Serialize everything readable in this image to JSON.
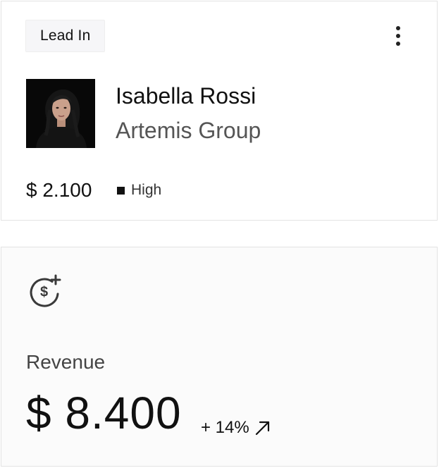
{
  "lead_card": {
    "stage_tag": "Lead In",
    "menu_icon": "more-vertical-icon",
    "contact": {
      "name": "Isabella Rossi",
      "company": "Artemis Group",
      "avatar_icon": "avatar-photo"
    },
    "deal_amount": "$ 2.100",
    "priority": {
      "label": "High",
      "indicator_color": "#111111"
    }
  },
  "revenue_card": {
    "icon": "dollar-plus-icon",
    "label": "Revenue",
    "value": "$ 8.400",
    "change": "+ 14%",
    "change_icon": "arrow-up-right-icon"
  }
}
